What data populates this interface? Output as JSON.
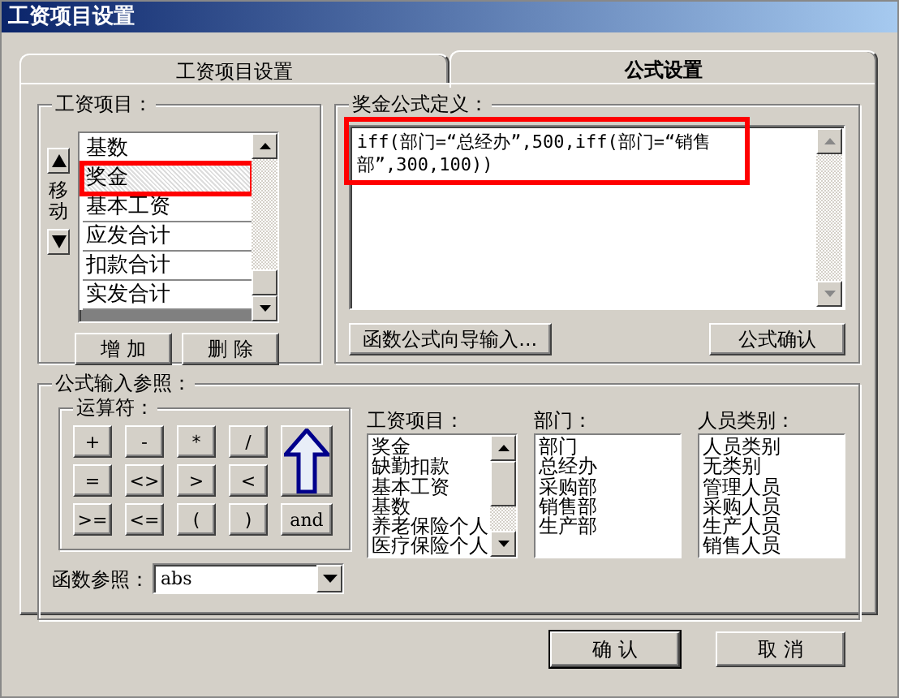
{
  "window": {
    "title": "工资项目设置"
  },
  "tabs": [
    {
      "label": "工资项目设置",
      "selected": false
    },
    {
      "label": "公式设置",
      "selected": true
    }
  ],
  "salary_items": {
    "label": "工资项目：",
    "move_label": "移动",
    "items": [
      {
        "label": "基数",
        "selected": false,
        "highlighted": false
      },
      {
        "label": "奖金",
        "selected": true,
        "highlighted": true
      },
      {
        "label": "基本工资",
        "selected": false,
        "highlighted": false
      },
      {
        "label": "应发合计",
        "selected": false,
        "highlighted": false
      },
      {
        "label": "扣款合计",
        "selected": false,
        "highlighted": false
      },
      {
        "label": "实发合计",
        "selected": false,
        "highlighted": false
      }
    ],
    "buttons": [
      "增 加",
      "删 除"
    ]
  },
  "formula": {
    "label": "奖金公式定义：",
    "value": "iff(部门=“总经办”,500,iff(部门=“销售部”,300,100))",
    "highlighted": true,
    "buttons": [
      "函数公式向导输入...",
      "公式确认"
    ]
  },
  "reference": {
    "label": "公式输入参照：",
    "operators": {
      "label": "运算符：",
      "keys": [
        "+",
        "-",
        "*",
        "/",
        "=",
        "<>",
        ">",
        "<",
        ">=",
        "<=",
        "(",
        ")",
        "and"
      ]
    },
    "function": {
      "label": "函数参照：",
      "value": "abs"
    },
    "lists": [
      {
        "label": "工资项目：",
        "scrollbar": true,
        "items": [
          "奖金",
          "缺勤扣款",
          "基本工资",
          "基数",
          "养老保险个人",
          "医疗保险个人"
        ]
      },
      {
        "label": "部门：",
        "scrollbar": false,
        "items": [
          "部门",
          "总经办",
          "采购部",
          "销售部",
          "生产部"
        ]
      },
      {
        "label": "人员类别：",
        "scrollbar": false,
        "items": [
          "人员类别",
          "无类别",
          "管理人员",
          "采购人员",
          "生产人员",
          "销售人员"
        ]
      }
    ]
  },
  "buttons": [
    "确 认",
    "取 消"
  ]
}
